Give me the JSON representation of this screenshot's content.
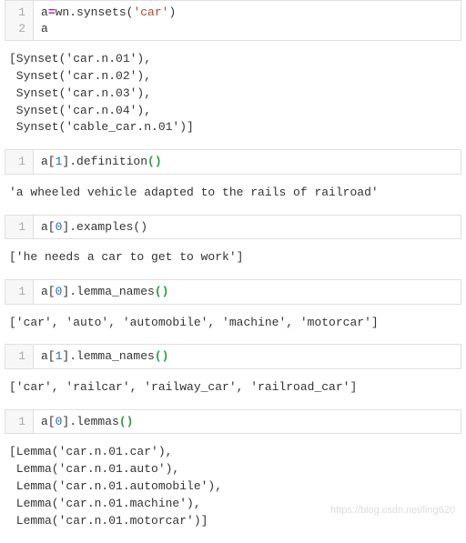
{
  "blocks": [
    {
      "type": "code",
      "gutter": "1\n2",
      "tokens": [
        {
          "t": "a",
          "c": ""
        },
        {
          "t": "=",
          "c": "op"
        },
        {
          "t": "wn.synsets(",
          "c": ""
        },
        {
          "t": "'car'",
          "c": "str"
        },
        {
          "t": ")\na",
          "c": ""
        }
      ]
    },
    {
      "type": "output",
      "text": "[Synset('car.n.01'),\n Synset('car.n.02'),\n Synset('car.n.03'),\n Synset('car.n.04'),\n Synset('cable_car.n.01')]"
    },
    {
      "type": "code",
      "gutter": "1",
      "tokens": [
        {
          "t": "a[",
          "c": ""
        },
        {
          "t": "1",
          "c": "num"
        },
        {
          "t": "].definition",
          "c": ""
        },
        {
          "t": "()",
          "c": "paren-g"
        }
      ]
    },
    {
      "type": "output",
      "text": "'a wheeled vehicle adapted to the rails of railroad'"
    },
    {
      "type": "code",
      "gutter": "1",
      "tokens": [
        {
          "t": "a[",
          "c": ""
        },
        {
          "t": "0",
          "c": "num"
        },
        {
          "t": "].examples()",
          "c": ""
        }
      ]
    },
    {
      "type": "output",
      "text": "['he needs a car to get to work']"
    },
    {
      "type": "code",
      "gutter": "1",
      "tokens": [
        {
          "t": "a[",
          "c": ""
        },
        {
          "t": "0",
          "c": "num"
        },
        {
          "t": "].lemma_names",
          "c": ""
        },
        {
          "t": "()",
          "c": "paren-g"
        }
      ]
    },
    {
      "type": "output",
      "text": "['car', 'auto', 'automobile', 'machine', 'motorcar']"
    },
    {
      "type": "code",
      "gutter": "1",
      "tokens": [
        {
          "t": "a[",
          "c": ""
        },
        {
          "t": "1",
          "c": "num"
        },
        {
          "t": "].lemma_names",
          "c": ""
        },
        {
          "t": "()",
          "c": "paren-g"
        }
      ]
    },
    {
      "type": "output",
      "text": "['car', 'railcar', 'railway_car', 'railroad_car']"
    },
    {
      "type": "code",
      "gutter": "1",
      "tokens": [
        {
          "t": "a[",
          "c": ""
        },
        {
          "t": "0",
          "c": "num"
        },
        {
          "t": "].lemmas",
          "c": ""
        },
        {
          "t": "()",
          "c": "paren-g"
        }
      ]
    },
    {
      "type": "output",
      "text": "[Lemma('car.n.01.car'),\n Lemma('car.n.01.auto'),\n Lemma('car.n.01.automobile'),\n Lemma('car.n.01.machine'),\n Lemma('car.n.01.motorcar')]"
    }
  ],
  "watermark": "https://blog.csdn.net/ling620"
}
